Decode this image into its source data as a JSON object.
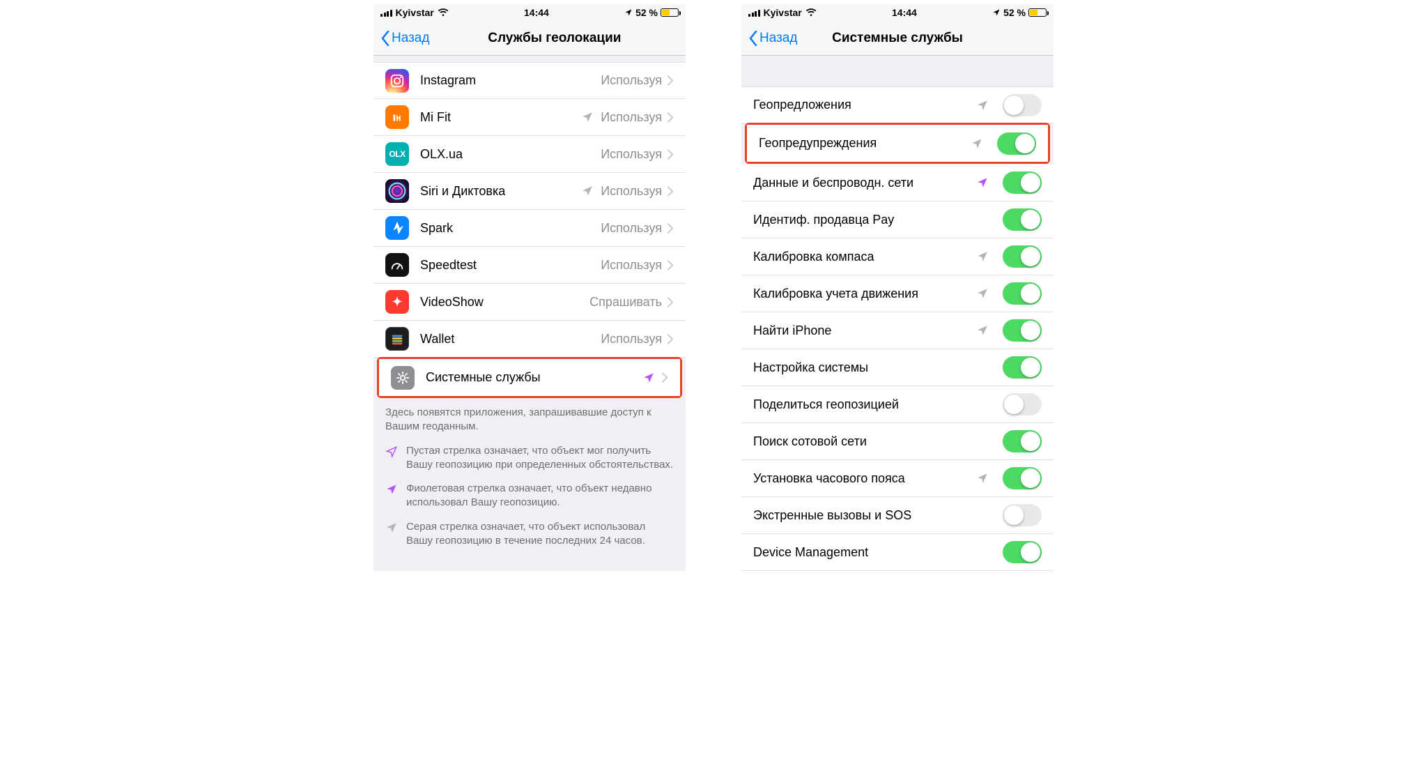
{
  "status": {
    "carrier": "Kyivstar",
    "time": "14:44",
    "battery_text": "52 %",
    "battery_level": 52,
    "battery_color": "#ffcc00"
  },
  "screen1": {
    "back_label": "Назад",
    "title": "Службы геолокации",
    "apps": [
      {
        "name": "Instagram",
        "status": "Используя",
        "arrow": "none",
        "icon": "instagram"
      },
      {
        "name": "Mi Fit",
        "status": "Используя",
        "arrow": "gray",
        "icon": "mifit"
      },
      {
        "name": "OLX.ua",
        "status": "Используя",
        "arrow": "none",
        "icon": "olx"
      },
      {
        "name": "Siri и Диктовка",
        "status": "Используя",
        "arrow": "gray",
        "icon": "siri"
      },
      {
        "name": "Spark",
        "status": "Используя",
        "arrow": "none",
        "icon": "spark"
      },
      {
        "name": "Speedtest",
        "status": "Используя",
        "arrow": "none",
        "icon": "speedtest"
      },
      {
        "name": "VideoShow",
        "status": "Cпрашивать",
        "arrow": "none",
        "icon": "videoshow"
      },
      {
        "name": "Wallet",
        "status": "Используя",
        "arrow": "none",
        "icon": "wallet"
      }
    ],
    "system_row": {
      "name": "Системные службы",
      "arrow": "purple",
      "icon": "system"
    },
    "footer_intro": "Здесь появятся приложения, запрашивавшие доступ к Вашим геоданным.",
    "legend": [
      {
        "arrow": "hollow-purple",
        "text": "Пустая стрелка означает, что объект мог получить Вашу геопозицию при определенных обстоятельствах."
      },
      {
        "arrow": "purple",
        "text": "Фиолетовая стрелка означает, что объект недавно использовал Вашу геопозицию."
      },
      {
        "arrow": "gray",
        "text": "Серая стрелка означает, что объект использовал Вашу геопозицию в течение последних 24 часов."
      }
    ]
  },
  "screen2": {
    "back_label": "Назад",
    "title": "Системные службы",
    "rows": [
      {
        "name": "Геопредложения",
        "arrow": "gray",
        "toggle": false,
        "highlight": false
      },
      {
        "name": "Геопредупреждения",
        "arrow": "gray",
        "toggle": true,
        "highlight": true
      },
      {
        "name": "Данные и беспроводн. сети",
        "arrow": "purple",
        "toggle": true,
        "highlight": false
      },
      {
        "name": "Идентиф. продавца Pay",
        "arrow": "none",
        "toggle": true,
        "highlight": false
      },
      {
        "name": "Калибровка компаса",
        "arrow": "gray",
        "toggle": true,
        "highlight": false
      },
      {
        "name": "Калибровка учета движения",
        "arrow": "gray",
        "toggle": true,
        "highlight": false
      },
      {
        "name": "Найти iPhone",
        "arrow": "gray",
        "toggle": true,
        "highlight": false
      },
      {
        "name": "Настройка системы",
        "arrow": "none",
        "toggle": true,
        "highlight": false
      },
      {
        "name": "Поделиться геопозицией",
        "arrow": "none",
        "toggle": false,
        "highlight": false
      },
      {
        "name": "Поиск сотовой сети",
        "arrow": "none",
        "toggle": true,
        "highlight": false
      },
      {
        "name": "Установка часового пояса",
        "arrow": "gray",
        "toggle": true,
        "highlight": false
      },
      {
        "name": "Экстренные вызовы и SOS",
        "arrow": "none",
        "toggle": false,
        "highlight": false
      },
      {
        "name": "Device Management",
        "arrow": "none",
        "toggle": true,
        "highlight": false
      }
    ]
  }
}
